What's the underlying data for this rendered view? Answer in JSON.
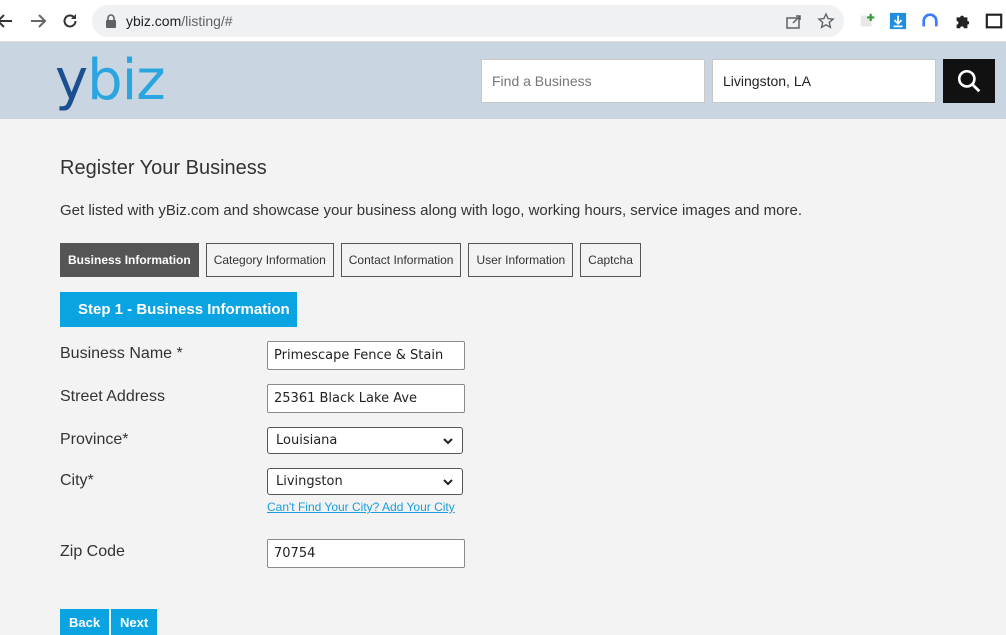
{
  "browser": {
    "url_host": "ybiz.com",
    "url_path": "/listing/#"
  },
  "header": {
    "logo_y": "y",
    "logo_biz": "biz",
    "search_what_placeholder": "Find a Business",
    "search_where_value": "Livingston, LA"
  },
  "page": {
    "title": "Register Your Business",
    "subtitle": "Get listed with yBiz.com and showcase your business along with logo, working hours, service images and more."
  },
  "tabs": [
    {
      "label": "Business Information",
      "active": true
    },
    {
      "label": "Category Information",
      "active": false
    },
    {
      "label": "Contact Information",
      "active": false
    },
    {
      "label": "User Information",
      "active": false
    },
    {
      "label": "Captcha",
      "active": false
    }
  ],
  "step_banner": "Step 1 - Business Information",
  "form": {
    "business_name_label": "Business Name *",
    "business_name_value": "Primescape Fence & Stain",
    "street_label": "Street Address",
    "street_value": "25361 Black Lake Ave",
    "province_label": "Province*",
    "province_value": "Louisiana",
    "city_label": "City*",
    "city_value": "Livingston",
    "add_city_link": "Can't Find Your City? Add Your City",
    "zip_label": "Zip Code",
    "zip_value": "70754"
  },
  "buttons": {
    "back": "Back",
    "next": "Next"
  },
  "colors": {
    "accent": "#0aa4e3",
    "header_bg": "#c9d6e2",
    "tab_active_bg": "#555555"
  }
}
